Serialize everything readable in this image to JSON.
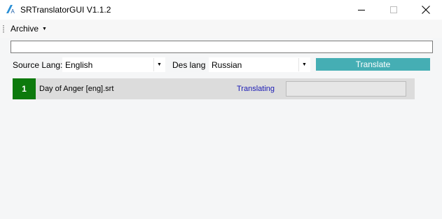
{
  "window": {
    "title": "SRTranslatorGUI V1.1.2"
  },
  "menu": {
    "archive_label": "Archive"
  },
  "path_input": {
    "value": "",
    "placeholder": ""
  },
  "controls": {
    "source_lang_label": "Source Lang:",
    "source_lang_value": "English",
    "des_lang_label": "Des lang",
    "des_lang_value": "Russian",
    "translate_label": "Translate"
  },
  "jobs": [
    {
      "number": "1",
      "file": "Day of Anger [eng].srt",
      "status": "Translating",
      "progress": 0
    }
  ],
  "colors": {
    "accent": "#45aeb4",
    "job_number_bg": "#0d7a0d",
    "status_text": "#1a1ab4"
  },
  "icons": {
    "app": "translate-icon",
    "minimize": "minimize-icon",
    "maximize": "maximize-icon",
    "close": "close-icon",
    "dropdown": "chevron-down-icon"
  }
}
